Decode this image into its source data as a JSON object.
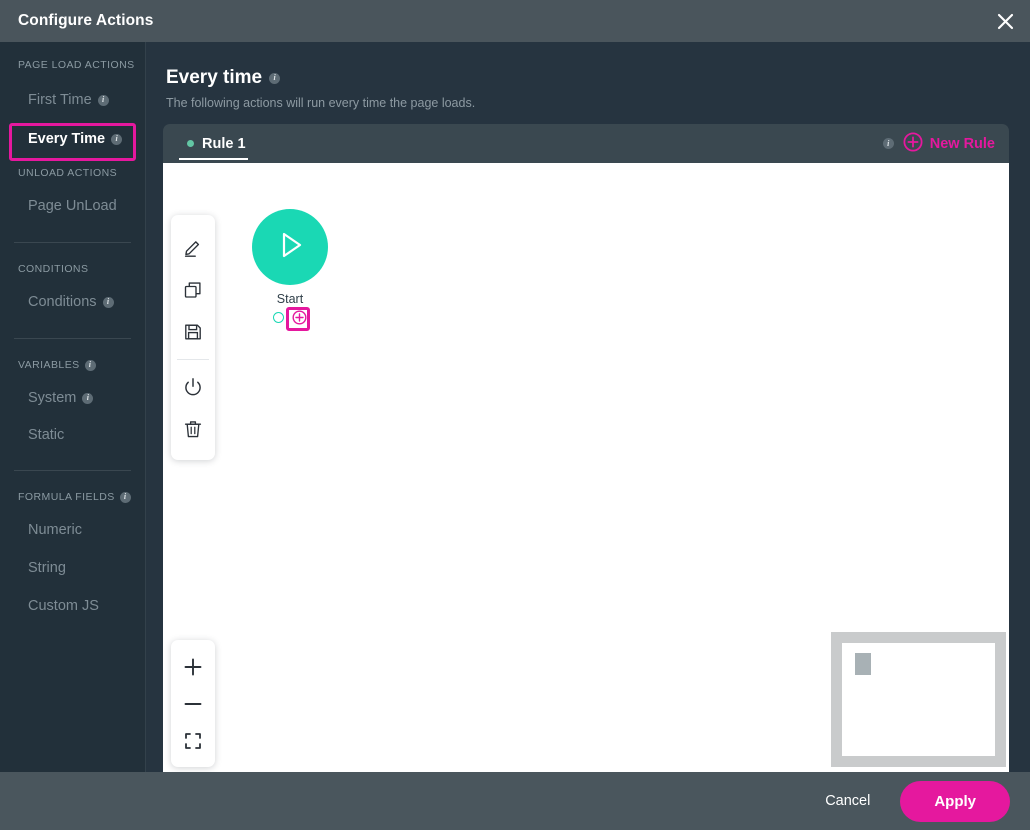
{
  "window": {
    "title": "Configure Actions",
    "close_icon": "close-icon"
  },
  "sidebar": {
    "groups": [
      {
        "title": "PAGE LOAD ACTIONS",
        "title_has_info": false,
        "items": [
          {
            "label": "First Time",
            "info": true,
            "active": false
          },
          {
            "label": "Every Time",
            "info": true,
            "active": true,
            "highlighted": true
          }
        ]
      },
      {
        "title": "UNLOAD ACTIONS",
        "title_has_info": false,
        "items": [
          {
            "label": "Page UnLoad",
            "info": false,
            "active": false
          }
        ]
      },
      {
        "title": "CONDITIONS",
        "title_has_info": false,
        "items": [
          {
            "label": "Conditions",
            "info": true,
            "active": false
          }
        ]
      },
      {
        "title": "VARIABLES",
        "title_has_info": true,
        "items": [
          {
            "label": "System",
            "info": true,
            "active": false
          },
          {
            "label": "Static",
            "info": false,
            "active": false
          }
        ]
      },
      {
        "title": "FORMULA FIELDS",
        "title_has_info": true,
        "items": [
          {
            "label": "Numeric",
            "info": false,
            "active": false
          },
          {
            "label": "String",
            "info": false,
            "active": false
          },
          {
            "label": "Custom JS",
            "info": false,
            "active": false
          }
        ]
      }
    ]
  },
  "main": {
    "title": "Every time",
    "title_info": true,
    "subtitle": "The following actions will run every time the page loads.",
    "tabs": [
      {
        "label": "Rule 1",
        "selected": true,
        "dot_color": "#63c6a4"
      }
    ],
    "tab_info": true,
    "new_rule_label": "New Rule",
    "new_rule_icon": "plus-circle-icon"
  },
  "canvas": {
    "toolbar": [
      {
        "icon": "pencil-icon",
        "name": "edit"
      },
      {
        "icon": "copy-icon",
        "name": "copy"
      },
      {
        "icon": "save-floppy-icon",
        "name": "save"
      },
      {
        "icon": "power-icon",
        "name": "power"
      },
      {
        "icon": "trash-icon",
        "name": "delete"
      }
    ],
    "start_node": {
      "label": "Start",
      "icon": "play-icon",
      "color": "#1ad8b4",
      "ports": [
        {
          "icon": "circle-port-icon",
          "name": "output-port"
        },
        {
          "icon": "plus-circle-icon",
          "name": "add-node-port",
          "highlighted": true
        }
      ]
    },
    "zoom_controls": [
      {
        "icon": "plus-icon",
        "name": "zoom-in"
      },
      {
        "icon": "minus-icon",
        "name": "zoom-out"
      },
      {
        "icon": "fit-screen-icon",
        "name": "fit-to-screen"
      }
    ],
    "minimap": {
      "name": "minimap"
    }
  },
  "footer": {
    "cancel_label": "Cancel",
    "apply_label": "Apply"
  },
  "colors": {
    "accent_magenta": "#e5189e",
    "accent_teal": "#1ad8b4",
    "titlebar_bg": "#4a555c",
    "sidebar_bg": "#22303a",
    "main_bg": "#263440",
    "tabstrip_bg": "#3a4850",
    "footer_bg": "#4a565d"
  }
}
